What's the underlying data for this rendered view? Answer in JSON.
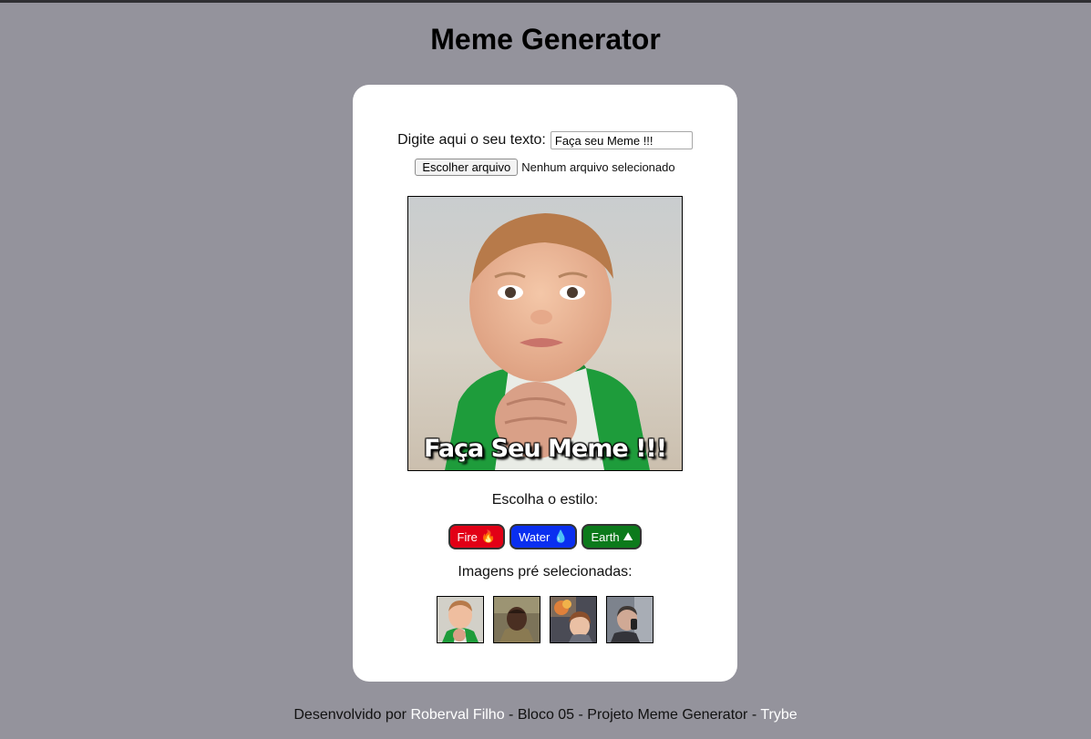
{
  "header": {
    "title": "Meme Generator"
  },
  "form": {
    "text_label": "Digite aqui o seu texto:",
    "text_value": "Faça seu Meme !!!",
    "file_button_label": "Escolher arquivo",
    "file_status": "Nenhum arquivo selecionado"
  },
  "meme": {
    "caption": "Faça Seu Meme !!!",
    "image": "success-kid"
  },
  "styles": {
    "label": "Escolha o estilo:",
    "buttons": [
      {
        "label": "Fire",
        "icon": "fire-icon",
        "glyph": "🔥",
        "color": "#e20016"
      },
      {
        "label": "Water",
        "icon": "droplet-icon",
        "glyph": "💧",
        "color": "#0a2ff0"
      },
      {
        "label": "Earth",
        "icon": "mountain-icon",
        "glyph": "⛰",
        "color": "#0c7a1b"
      }
    ]
  },
  "preset": {
    "label": "Imagens pré selecionadas:",
    "images": [
      "success-kid",
      "confused-boy",
      "disaster-girl",
      "phone-guy"
    ]
  },
  "footer": {
    "prefix": "Desenvolvido por ",
    "author": "Roberval Filho",
    "middle": " - Bloco 05 - Projeto Meme Generator - ",
    "org": "Trybe"
  },
  "colors": {
    "background": "#94939c",
    "card": "#ffffff",
    "fire": "#e20016",
    "water": "#0a2ff0",
    "earth": "#0c7a1b"
  }
}
